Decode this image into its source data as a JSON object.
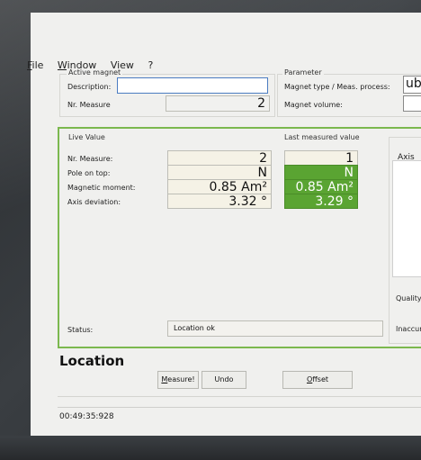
{
  "menu": {
    "file": {
      "u": "F",
      "rest": "ile"
    },
    "window": {
      "u": "W",
      "rest": "indow"
    },
    "view": {
      "u": "V",
      "rest": "iew"
    },
    "help": "?"
  },
  "active_magnet": {
    "title": "Active magnet",
    "description_label": "Description:",
    "description_value": "",
    "nr_label": "Nr. Measure",
    "nr_value": "2"
  },
  "parameter": {
    "title": "Parameter",
    "type_label": "Magnet type / Meas. process:",
    "type_value": "ube",
    "volume_label": "Magnet volume:",
    "volume_value": ""
  },
  "live_value": {
    "title": "Live Value",
    "rows": [
      {
        "label": "Nr. Measure:",
        "value": "2"
      },
      {
        "label": "Pole on top:",
        "value": "N"
      },
      {
        "label": "Magnetic moment:",
        "value": "0.85 Am²"
      },
      {
        "label": "Axis deviation:",
        "value": "3.32 °"
      }
    ]
  },
  "last_measured": {
    "title": "Last measured value",
    "values": [
      "1",
      "N",
      "0.85 Am²",
      "3.29 °"
    ]
  },
  "side": {
    "axis": "Axis",
    "quality": "Quality",
    "inaccuracy": "Inaccur"
  },
  "status": {
    "label": "Status:",
    "value": "Location ok"
  },
  "location": {
    "title": "Location",
    "measure_u": "M",
    "measure_rest": "easure!",
    "undo": "Undo",
    "offset_u": "O",
    "offset_rest": "ffset"
  },
  "timestamp": "00:49:35:928",
  "colors": {
    "accent_green": "#5aa432",
    "frame_green": "#7bb84e",
    "input_blue": "#4b7cc1"
  }
}
